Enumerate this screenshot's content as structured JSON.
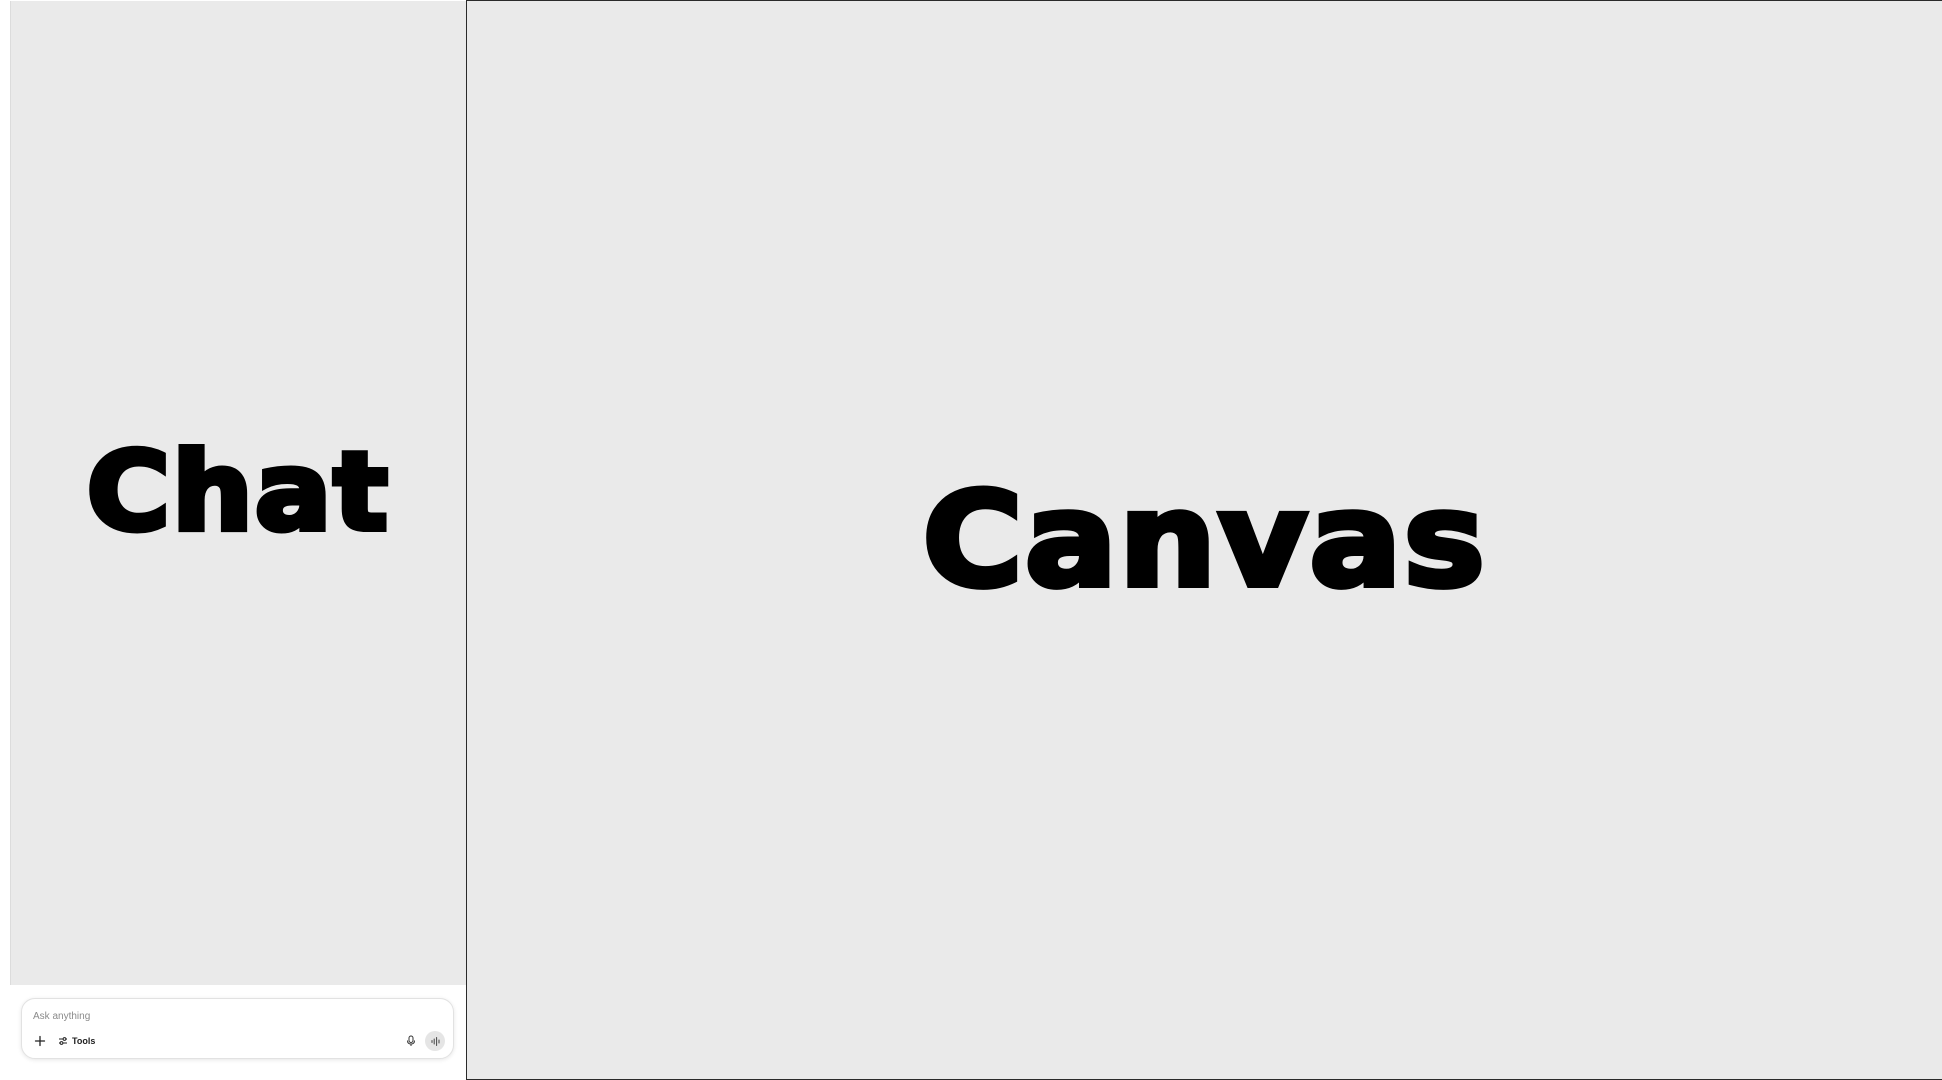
{
  "chat": {
    "heading": "Chat"
  },
  "canvas": {
    "heading": "Canvas"
  },
  "composer": {
    "placeholder": "Ask anything",
    "tools_label": "Tools",
    "icons": {
      "add": "plus-icon",
      "tools": "sliders-icon",
      "mic": "microphone-icon",
      "voice": "voice-mode-icon"
    }
  },
  "colors": {
    "panel_background": "#eaeaea",
    "text": "#000000",
    "canvas_border": "#2a2a2a",
    "voice_button": "#e5e5e5"
  }
}
